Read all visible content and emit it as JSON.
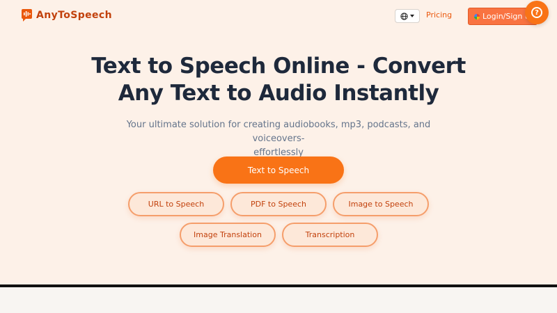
{
  "header": {
    "brand": "AnyToSpeech",
    "pricing_label": "Pricing",
    "login_label": "Login/Sign u"
  },
  "hero": {
    "title_line1": "Text to Speech Online - Convert",
    "title_line2": "Any Text to Audio Instantly",
    "subtitle_line1": "Your ultimate solution for creating audiobooks, mp3, podcasts, and voiceovers-",
    "subtitle_line2": "effortlessly"
  },
  "primary_action": {
    "label": "Text to Speech"
  },
  "tools": {
    "row1": [
      "URL to Speech",
      "PDF to Speech",
      "Image to Speech"
    ],
    "row2": [
      "Image Translation",
      "Transcription"
    ]
  },
  "icons": {
    "logo": "sound-wave-bubble-icon",
    "language": "globe-icon",
    "language_caret": "chevron-down-icon",
    "login": "google-icon",
    "help": "help-circle-icon"
  },
  "colors": {
    "accent": "#f97316",
    "background": "#fdf1e8",
    "title": "#1e293b",
    "subtitle": "#64748b"
  }
}
